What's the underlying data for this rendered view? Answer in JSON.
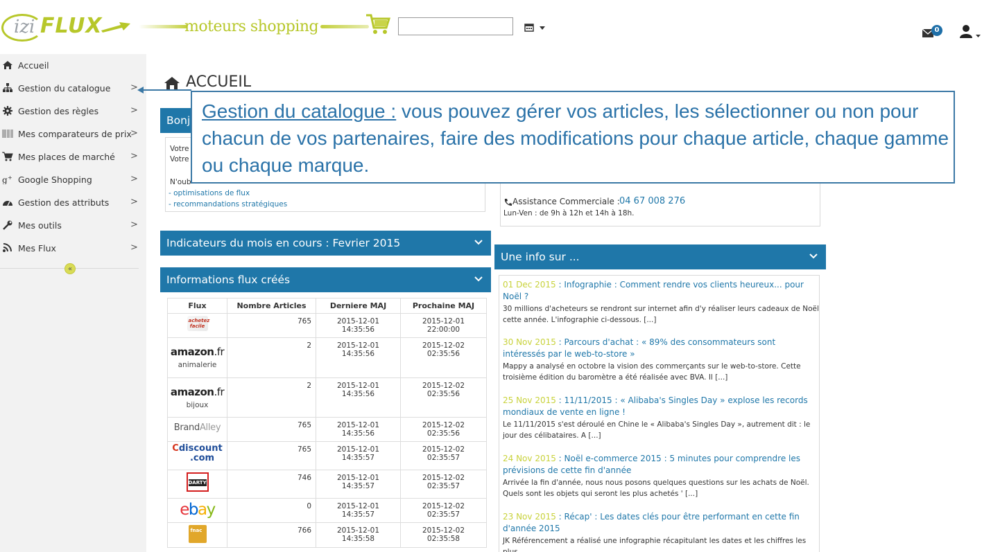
{
  "header": {
    "logo_izi": "izi",
    "logo_flux": "FLUX",
    "banner_text": "moteurs shopping",
    "date_input_value": "",
    "mail_badge": "0",
    "colors": {
      "brand_green": "#b7c72a",
      "primary_blue": "#1f77a9"
    }
  },
  "sidebar": {
    "items": [
      {
        "label": "Accueil",
        "icon": "home-icon",
        "chevron": ""
      },
      {
        "label": "Gestion du catalogue",
        "icon": "sitemap-icon",
        "chevron": ">"
      },
      {
        "label": "Gestion des règles",
        "icon": "gear-icon",
        "chevron": ">"
      },
      {
        "label": "Mes comparateurs de prix",
        "icon": "barcode-icon",
        "chevron": ">"
      },
      {
        "label": "Mes places de marché",
        "icon": "cart-icon",
        "chevron": ">"
      },
      {
        "label": "Google Shopping",
        "icon": "google-plus-icon",
        "chevron": ">"
      },
      {
        "label": "Gestion des attributs",
        "icon": "gauge-icon",
        "chevron": ">"
      },
      {
        "label": "Mes outils",
        "icon": "wrench-icon",
        "chevron": ">"
      },
      {
        "label": "Mes Flux",
        "icon": "rss-icon",
        "chevron": ">"
      }
    ],
    "collapse_label": "«"
  },
  "main": {
    "page_title": "ACCUEIL",
    "welcome": {
      "title_fragment": "Bonj",
      "line1": "Votre",
      "line2": "Votre",
      "reminder": "N'oub",
      "links": [
        "- optimisations de flux",
        "- recommandations stratégiques"
      ]
    },
    "contact": {
      "label": "Assistance Commerciale :",
      "phone": "04 67 008 276",
      "hours": "Lun-Ven : de 9h à 12h et 14h à 18h."
    },
    "indicators_title": "Indicateurs du mois en cours : Fevrier 2015",
    "flux_title": "Informations flux créés",
    "table": {
      "headers": [
        "Flux",
        "Nombre Articles",
        "Derniere MAJ",
        "Prochaine MAJ"
      ],
      "rows": [
        {
          "logo": "achetez-facile-logo",
          "sub": "",
          "count": "765",
          "last": "2015-12-01 14:35:56",
          "next": "2015-12-01 22:00:00"
        },
        {
          "logo": "amazon-logo",
          "sub": "animalerie",
          "count": "2",
          "last": "2015-12-01 14:35:56",
          "next": "2015-12-02 02:35:56"
        },
        {
          "logo": "amazon-logo",
          "sub": "bijoux",
          "count": "2",
          "last": "2015-12-01 14:35:56",
          "next": "2015-12-02 02:35:56"
        },
        {
          "logo": "brandalley-logo",
          "sub": "",
          "count": "765",
          "last": "2015-12-01 14:35:56",
          "next": "2015-12-02 02:35:56"
        },
        {
          "logo": "cdiscount-logo",
          "sub": "",
          "count": "765",
          "last": "2015-12-01 14:35:57",
          "next": "2015-12-02 02:35:57"
        },
        {
          "logo": "darty-logo",
          "sub": "",
          "count": "746",
          "last": "2015-12-01 14:35:57",
          "next": "2015-12-02 02:35:57"
        },
        {
          "logo": "ebay-logo",
          "sub": "",
          "count": "0",
          "last": "2015-12-01 14:35:57",
          "next": "2015-12-02 02:35:57"
        },
        {
          "logo": "fnac-logo",
          "sub": "",
          "count": "766",
          "last": "2015-12-01 14:35:58",
          "next": "2015-12-02 02:35:58"
        }
      ],
      "logo_text": {
        "amazon": "amazon",
        "amazon_fr": ".fr",
        "brand1": "Brand",
        "brand2": "Alley",
        "cdisc_c": "C",
        "cdisc_rest": "discount",
        "cdisc_com": ".com",
        "darty": "DARTY",
        "ebay_e": "e",
        "ebay_b": "b",
        "ebay_a": "a",
        "ebay_y": "y",
        "af": "achetez facile",
        "fnac": "fnac"
      }
    },
    "news": {
      "title": "Une info sur ...",
      "items": [
        {
          "date": "01 Dec 2015",
          "title": " : Infographie : Comment rendre vos clients heureux... pour Noël ?",
          "text": "30 millions d'acheteurs se rendront sur internet afin d'y réaliser leurs cadeaux de Noël cette année. L'infographie ci-dessous. [...]"
        },
        {
          "date": "30 Nov 2015",
          "title": " : Parcours d'achat : « 89% des consommateurs sont intéressés par le web-to-store »",
          "text": "Mappy a analysé en octobre la vision des commerçants sur le web-to-store. Cette troisième édition du baromètre a été réalisée avec BVA. Il [...]"
        },
        {
          "date": "25 Nov 2015",
          "title": " : 11/11/2015 : « Alibaba's Singles Day » explose les records mondiaux de vente en ligne !",
          "text": "Le 11/11/2015 s'est déroulé en Chine le « Alibaba's Singles Day », autrement dit : le jour des célibataires. A [...]"
        },
        {
          "date": "24 Nov 2015",
          "title": " : Noël e-commerce 2015 : 5 minutes pour comprendre les prévisions de cette fin d'année",
          "text": "Arrivée la fin d'année, nous nous posons quelques questions sur les achats de Noël. Quels sont les objets qui seront les plus achetés ' [...]"
        },
        {
          "date": "23 Nov 2015",
          "title": " : Récap' : Les dates clés pour être performant en cette fin d'année 2015",
          "text": "JK Référencement a réalisé une infographie récapitulant les dates et les chiffres les plus"
        }
      ]
    }
  },
  "callout": {
    "heading": "Gestion du catalogue :",
    "text": " vous pouvez gérer vos articles, les sélectionner ou non pour chacun de vos partenaires, faire des modifications pour chaque article, chaque gamme ou chaque marque."
  }
}
